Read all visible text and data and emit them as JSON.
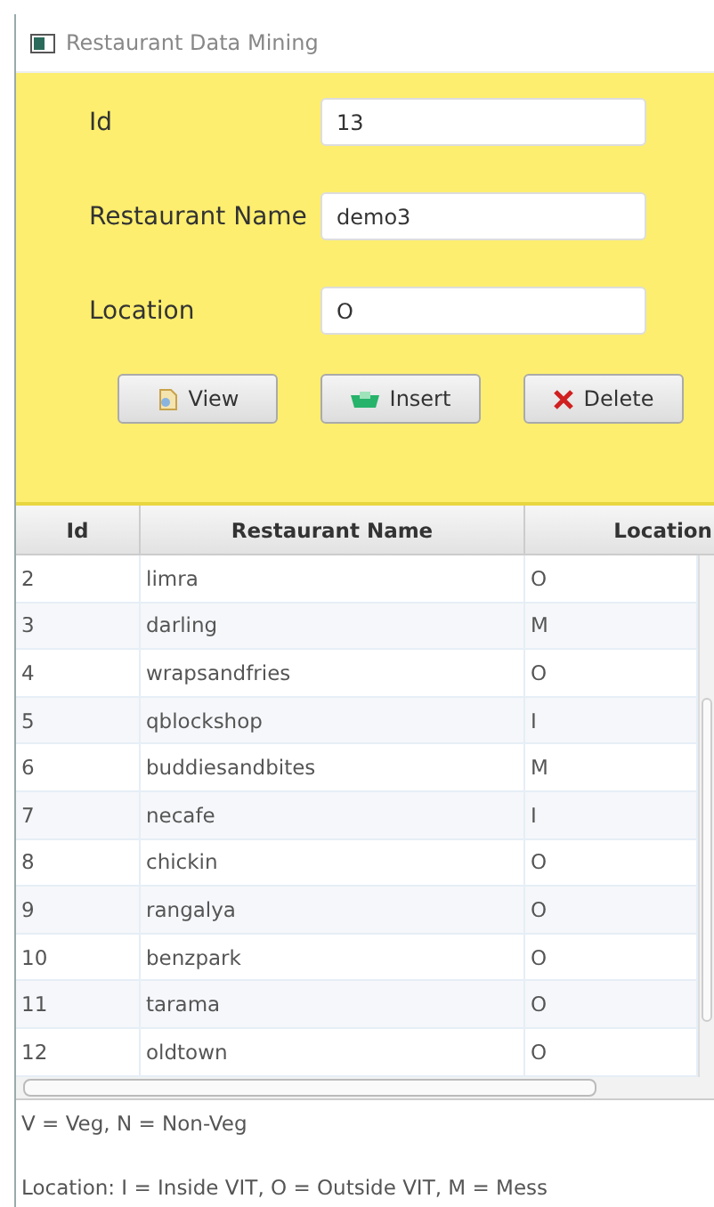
{
  "window": {
    "title": "Restaurant Data Mining"
  },
  "form": {
    "fields": [
      {
        "label": "Id",
        "value": "13"
      },
      {
        "label": "Restaurant Name",
        "value": "demo3"
      },
      {
        "label": "Location",
        "value": "O"
      }
    ],
    "buttons": [
      {
        "kind": "view",
        "label": "View"
      },
      {
        "kind": "insert",
        "label": "Insert"
      },
      {
        "kind": "delete",
        "label": "Delete"
      }
    ]
  },
  "table": {
    "columns": [
      "Id",
      "Restaurant Name",
      "Location"
    ],
    "rows": [
      [
        "2",
        "limra",
        "O"
      ],
      [
        "3",
        "darling",
        "M"
      ],
      [
        "4",
        "wrapsandfries",
        "O"
      ],
      [
        "5",
        "qblockshop",
        "I"
      ],
      [
        "6",
        "buddiesandbites",
        "M"
      ],
      [
        "7",
        "necafe",
        "I"
      ],
      [
        "8",
        "chickin",
        "O"
      ],
      [
        "9",
        "rangalya",
        "O"
      ],
      [
        "10",
        "benzpark",
        "O"
      ],
      [
        "11",
        "tarama",
        "O"
      ],
      [
        "12",
        "oldtown",
        "O"
      ]
    ]
  },
  "legend": [
    "V = Veg, N = Non-Veg",
    "Location: I = Inside VIT, O = Outside VIT, M = Mess"
  ]
}
